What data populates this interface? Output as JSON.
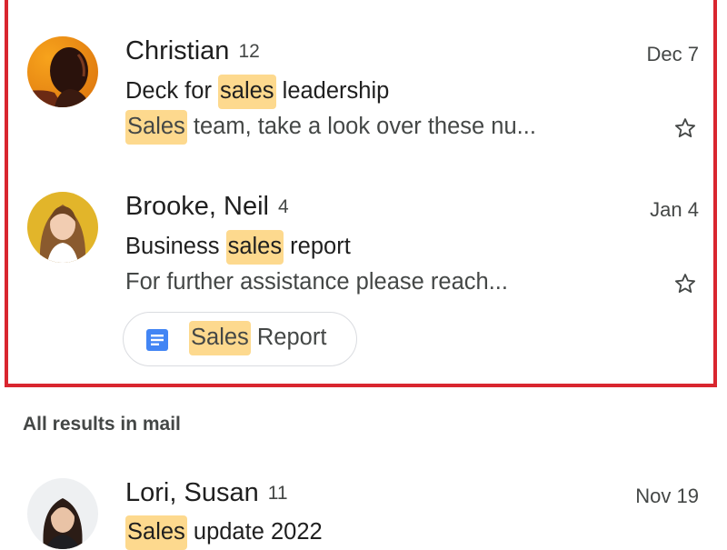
{
  "search_results": {
    "highlighted_threads": [
      {
        "sender": "Christian",
        "count": "12",
        "date": "Dec 7",
        "subject_before": "Deck for ",
        "subject_match": "sales",
        "subject_after": " leadership",
        "snippet_before": "",
        "snippet_match": "Sales",
        "snippet_after": " team, take a look over these nu...",
        "starred": false
      },
      {
        "sender": "Brooke, Neil",
        "count": "4",
        "date": "Jan 4",
        "subject_before": "Business ",
        "subject_match": "sales",
        "subject_after": " report",
        "snippet": "For further assistance please reach...",
        "starred": false,
        "attachment": {
          "icon": "google-docs-icon",
          "label_match": "Sales",
          "label_after": " Report"
        }
      }
    ],
    "section_title": "All results in mail",
    "mail_threads": [
      {
        "sender": "Lori, Susan",
        "count": "11",
        "date": "Nov 19",
        "subject_before": "",
        "subject_match": "Sales",
        "subject_after": " update 2022"
      }
    ]
  },
  "colors": {
    "highlight_border": "#d9262f",
    "match_highlight": "#fdd98e",
    "docs_blue": "#4285f4"
  }
}
